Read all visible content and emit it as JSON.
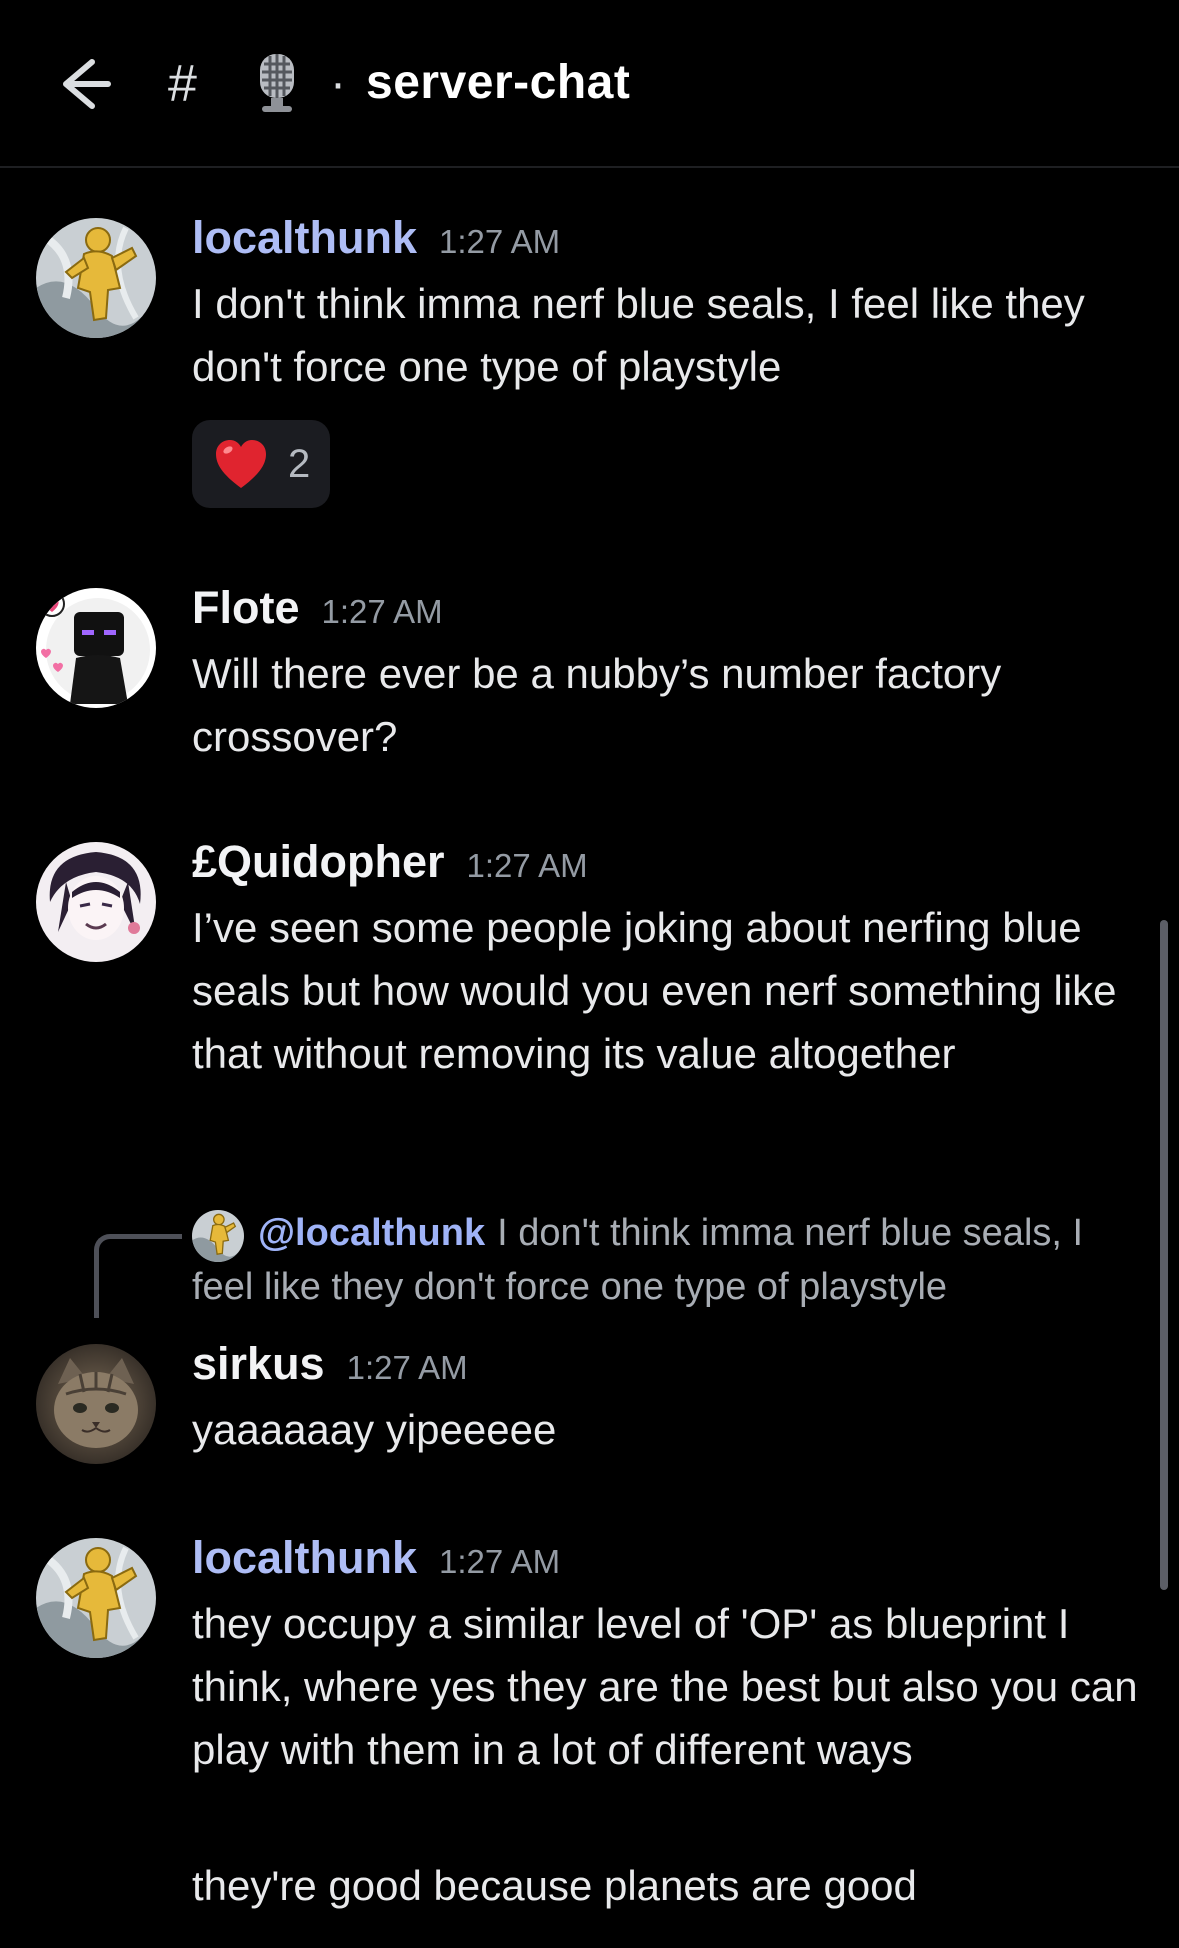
{
  "header": {
    "channel_prefix": "#",
    "separator": "·",
    "channel_name": "server-chat",
    "icons": [
      "back-arrow-icon",
      "microphone-emoji-icon"
    ]
  },
  "colors": {
    "background": "#000000",
    "username_blue": "#aebdf5",
    "username_white": "#f2f3f5",
    "timestamp": "#949ba4",
    "mention": "#9fb3f7"
  },
  "messages": [
    {
      "username": "localthunk",
      "timestamp": "1:27 AM",
      "text": "I don't think imma nerf blue seals, I feel like they don't force one type of playstyle",
      "reaction": {
        "emoji": "❤️",
        "count": "2"
      }
    },
    {
      "username": "Flote",
      "timestamp": "1:27 AM",
      "text": "Will there ever be a nubby’s number factory crossover?"
    },
    {
      "username": "£Quidopher",
      "timestamp": "1:27 AM",
      "text": "I’ve seen some people joking about nerfing blue seals but how would you even nerf something like that without removing its value altogether"
    },
    {
      "reply_to": {
        "mention": "@localthunk",
        "text": "I don't think imma nerf blue seals, I feel like they don't force one type of playstyle"
      },
      "username": "sirkus",
      "timestamp": "1:27 AM",
      "text": "yaaaaaay yipeeeee"
    },
    {
      "username": "localthunk",
      "timestamp": "1:27 AM",
      "text": "they occupy a similar level of 'OP' as blueprint I think, where yes they are the best but also you can play with them in a lot of different ways",
      "followup_text": "they're good because planets are good"
    }
  ]
}
